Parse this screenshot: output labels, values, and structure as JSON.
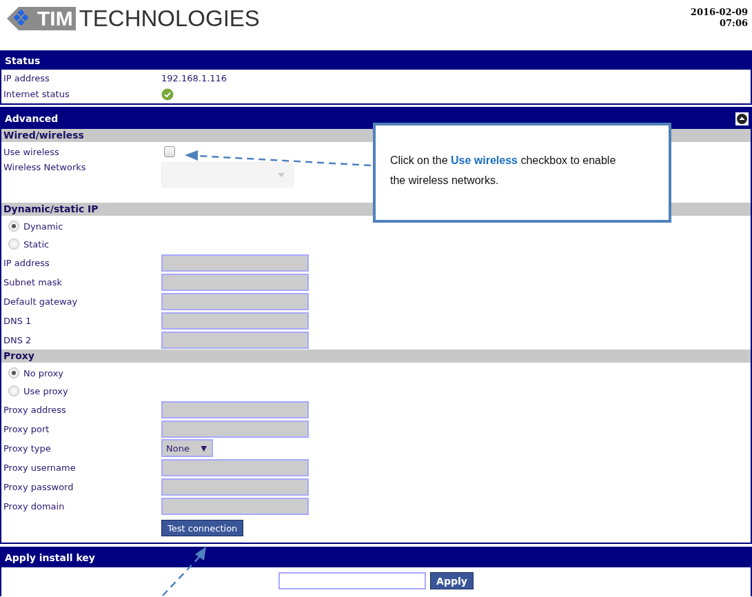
{
  "header": {
    "logo_mark": "TIM",
    "logo_text": "TECHNOLOGIES",
    "date": "2016-02-09",
    "time": "07:06"
  },
  "status": {
    "title": "Status",
    "rows": [
      {
        "kind": "text",
        "label": "IP address",
        "value": "192.168.1.116"
      },
      {
        "kind": "status_icon",
        "label": "Internet status",
        "ok": true
      }
    ]
  },
  "advanced": {
    "title": "Advanced",
    "expanded": true,
    "sections": [
      {
        "title": "Wired/wireless",
        "rows": [
          {
            "kind": "checkbox",
            "label": "Use wireless",
            "checked": false
          },
          {
            "kind": "dropdown",
            "label": "Wireless Networks",
            "disabled": true
          }
        ]
      },
      {
        "title": "Dynamic/static IP",
        "rows": [
          {
            "kind": "radio",
            "label": "Dynamic",
            "selected": true
          },
          {
            "kind": "radio",
            "label": "Static",
            "selected": false
          },
          {
            "kind": "field",
            "label": "IP address",
            "disabled": true
          },
          {
            "kind": "field",
            "label": "Subnet mask",
            "disabled": true
          },
          {
            "kind": "field",
            "label": "Default gateway",
            "disabled": true
          },
          {
            "kind": "field",
            "label": "DNS 1",
            "disabled": true
          },
          {
            "kind": "field",
            "label": "DNS 2",
            "disabled": true
          }
        ]
      },
      {
        "title": "Proxy",
        "rows": [
          {
            "kind": "radio",
            "label": "No proxy",
            "selected": true
          },
          {
            "kind": "radio",
            "label": "Use proxy",
            "selected": false
          },
          {
            "kind": "field",
            "label": "Proxy address",
            "disabled": true
          },
          {
            "kind": "field",
            "label": "Proxy port",
            "disabled": true
          },
          {
            "kind": "select",
            "label": "Proxy type",
            "value": "None",
            "arrow": "▼",
            "disabled": true
          },
          {
            "kind": "field",
            "label": "Proxy username",
            "disabled": true
          },
          {
            "kind": "field",
            "label": "Proxy password",
            "disabled": true
          },
          {
            "kind": "field",
            "label": "Proxy domain",
            "disabled": true
          },
          {
            "kind": "button",
            "label": "Test connection"
          }
        ]
      }
    ]
  },
  "install_key": {
    "title": "Apply install key",
    "button": "Apply"
  },
  "callout": {
    "text": "Click on the **Use wireless** checkbox to enable the wireless networks."
  }
}
